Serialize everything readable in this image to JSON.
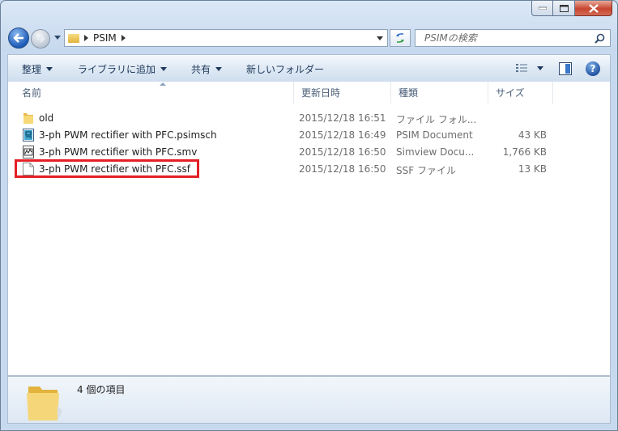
{
  "address": {
    "path": [
      "PSIM"
    ],
    "search_placeholder": "PSIMの検索"
  },
  "toolbar": {
    "organize": "整理",
    "library": "ライブラリに追加",
    "share": "共有",
    "new_folder": "新しいフォルダー"
  },
  "columns": {
    "name": "名前",
    "date": "更新日時",
    "type": "種類",
    "size": "サイズ"
  },
  "files": [
    {
      "name": "old",
      "date": "2015/12/18 16:51",
      "type": "ファイル フォル...",
      "size": "",
      "icon": "folder-icon"
    },
    {
      "name": "3-ph PWM rectifier with PFC.psimsch",
      "date": "2015/12/18 16:49",
      "type": "PSIM Document",
      "size": "43 KB",
      "icon": "psim-document-icon"
    },
    {
      "name": "3-ph PWM rectifier with PFC.smv",
      "date": "2015/12/18 16:50",
      "type": "Simview Docu...",
      "size": "1,766 KB",
      "icon": "simview-document-icon"
    },
    {
      "name": "3-ph PWM rectifier with PFC.ssf",
      "date": "2015/12/18 16:50",
      "type": "SSF ファイル",
      "size": "13 KB",
      "icon": "blank-file-icon"
    }
  ],
  "highlight_color": "#e41f26",
  "details": {
    "item_count": "4 個の項目"
  }
}
